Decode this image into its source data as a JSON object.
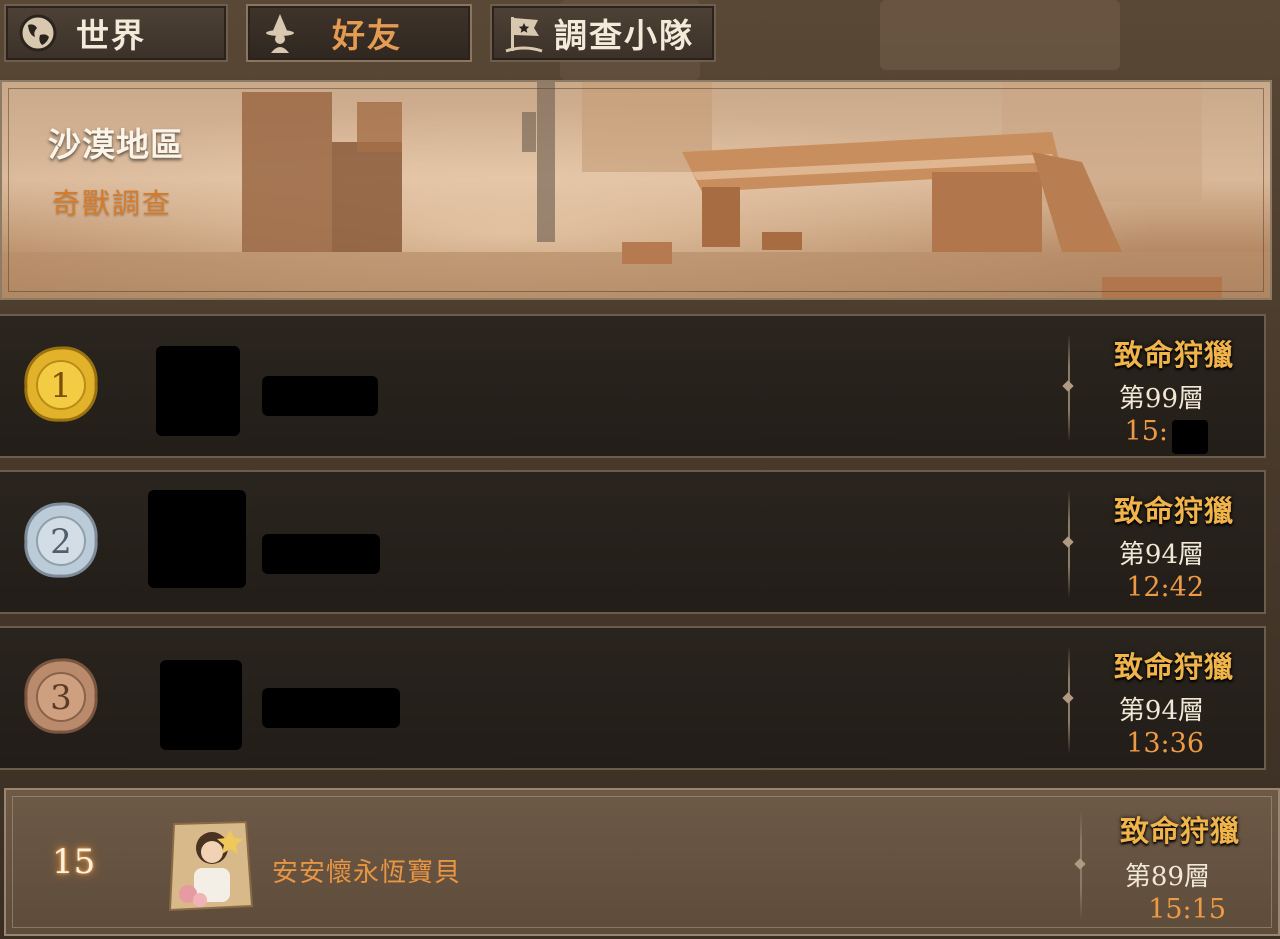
{
  "tabs": [
    {
      "label": "世界",
      "icon": "globe-icon",
      "active": false
    },
    {
      "label": "好友",
      "icon": "wizard-icon",
      "active": true
    },
    {
      "label": "調查小隊",
      "icon": "flag-icon",
      "active": false
    }
  ],
  "banner": {
    "title": "沙漠地區",
    "subtitle": "奇獸調查"
  },
  "leaderboard": [
    {
      "rank": "1",
      "medal": "gold-medal-icon",
      "mode": "致命狩獵",
      "floor": "第99層",
      "time": "15:"
    },
    {
      "rank": "2",
      "medal": "silver-medal-icon",
      "mode": "致命狩獵",
      "floor": "第94層",
      "time": "12:42"
    },
    {
      "rank": "3",
      "medal": "bronze-medal-icon",
      "mode": "致命狩獵",
      "floor": "第94層",
      "time": "13:36"
    }
  ],
  "self": {
    "rank": "15",
    "name": "安安懷永恆寶貝",
    "mode": "致命狩獵",
    "floor": "第89層",
    "time": "15:15"
  },
  "colors": {
    "accent_orange": "#e59b52",
    "mode_gold": "#f0b44a",
    "gold_medal": "#e2b22a",
    "silver_medal": "#bccbd8",
    "bronze_medal": "#b98a6c"
  }
}
